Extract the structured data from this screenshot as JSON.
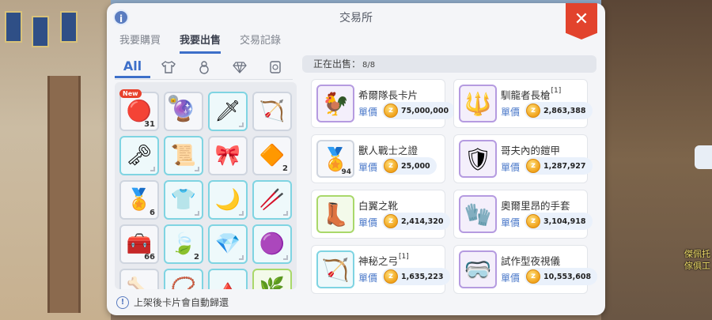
{
  "window": {
    "title": "交易所"
  },
  "tabs": [
    {
      "label": "我要購買",
      "active": false
    },
    {
      "label": "我要出售",
      "active": true
    },
    {
      "label": "交易記錄",
      "active": false
    }
  ],
  "categories": {
    "all_label": "All",
    "icons": [
      "shirt-icon",
      "gourd-icon",
      "gem-icon",
      "card-icon"
    ]
  },
  "inventory": {
    "slots": [
      {
        "icon": "red-jewel-icon",
        "glyph": "🔴",
        "count": "31",
        "badge": "New",
        "frame": "plain"
      },
      {
        "icon": "purple-flame-icon",
        "glyph": "🔮",
        "count": "",
        "badge": "",
        "locked": true,
        "frame": "plain"
      },
      {
        "icon": "blade-icon",
        "glyph": "🗡",
        "count": "",
        "badge": "",
        "frame": "teal"
      },
      {
        "icon": "bow-icon",
        "glyph": "🏹",
        "count": "",
        "badge": "",
        "frame": "plain"
      },
      {
        "icon": "key-icon",
        "glyph": "🗝",
        "count": "",
        "badge": "",
        "frame": "teal"
      },
      {
        "icon": "scroll-icon",
        "glyph": "📜",
        "count": "",
        "badge": "",
        "frame": "teal"
      },
      {
        "icon": "ribbon-icon",
        "glyph": "🎀",
        "count": "",
        "badge": "",
        "frame": "plain"
      },
      {
        "icon": "crystal-shard-icon",
        "glyph": "🔶",
        "count": "2",
        "badge": "",
        "frame": "plain"
      },
      {
        "icon": "certificate-icon",
        "glyph": "🏅",
        "count": "6",
        "badge": "",
        "frame": "plain"
      },
      {
        "icon": "armor-icon",
        "glyph": "👕",
        "count": "",
        "badge": "",
        "frame": "teal"
      },
      {
        "icon": "curved-bow-icon",
        "glyph": "🌙",
        "count": "",
        "badge": "",
        "frame": "teal"
      },
      {
        "icon": "staff-icon",
        "glyph": "🥢",
        "count": "",
        "badge": "",
        "frame": "teal"
      },
      {
        "icon": "chest-icon",
        "glyph": "🧰",
        "count": "66",
        "badge": "",
        "frame": "plain"
      },
      {
        "icon": "leaf-gem-icon",
        "glyph": "🍃",
        "count": "2",
        "badge": "",
        "frame": "teal"
      },
      {
        "icon": "blue-crystal-icon",
        "glyph": "💎",
        "count": "",
        "badge": "",
        "frame": "teal"
      },
      {
        "icon": "purple-stone-icon",
        "glyph": "🟣",
        "count": "",
        "badge": "",
        "frame": "teal"
      },
      {
        "icon": "bones-icon",
        "glyph": "🦴",
        "count": "",
        "badge": "",
        "frame": "plain"
      },
      {
        "icon": "necklace-icon",
        "glyph": "📿",
        "count": "",
        "badge": "",
        "frame": "teal"
      },
      {
        "icon": "spike-icon",
        "glyph": "🔺",
        "count": "",
        "badge": "",
        "frame": "teal"
      },
      {
        "icon": "leaf-icon",
        "glyph": "🌿",
        "count": "",
        "badge": "",
        "frame": "green"
      }
    ]
  },
  "footer": {
    "note": "上架後卡片會自動歸還"
  },
  "selling": {
    "header_label": "正在出售：",
    "count": "8/8",
    "price_label": "單價",
    "items": [
      {
        "name": "希爾隊長卡片",
        "ref": "",
        "price": "75,000,000",
        "icon": "captain-card-icon",
        "glyph": "🐓",
        "frame": "purple",
        "count": ""
      },
      {
        "name": "馴龍者長槍",
        "ref": "[1]",
        "price": "2,863,388",
        "icon": "spear-icon",
        "glyph": "🔱",
        "frame": "purple",
        "count": ""
      },
      {
        "name": "獸人戰士之證",
        "ref": "",
        "price": "25,000",
        "icon": "orc-certificate-icon",
        "glyph": "🏅",
        "frame": "plain",
        "count": "94"
      },
      {
        "name": "哥夫內的鎧甲",
        "ref": "",
        "price": "1,287,927",
        "icon": "plate-armor-icon",
        "glyph": "🛡",
        "frame": "purple",
        "count": ""
      },
      {
        "name": "白翼之靴",
        "ref": "",
        "price": "2,414,320",
        "icon": "boots-icon",
        "glyph": "👢",
        "frame": "green",
        "count": ""
      },
      {
        "name": "奧爾里昂的手套",
        "ref": "",
        "price": "3,104,918",
        "icon": "gauntlet-icon",
        "glyph": "🧤",
        "frame": "purple",
        "count": ""
      },
      {
        "name": "神秘之弓",
        "ref": "[1]",
        "price": "1,635,223",
        "icon": "mystic-bow-icon",
        "glyph": "🏹",
        "frame": "teal",
        "count": ""
      },
      {
        "name": "試作型夜視儀",
        "ref": "",
        "price": "10,553,608",
        "icon": "goggles-icon",
        "glyph": "🥽",
        "frame": "purple",
        "count": ""
      }
    ]
  },
  "background": {
    "npc_text_line1": "傑佩托",
    "npc_text_line2": "傢俱工"
  },
  "colors": {
    "accent": "#3d6fc9",
    "close": "#e2432d",
    "price_coin": "#f0a21b"
  }
}
